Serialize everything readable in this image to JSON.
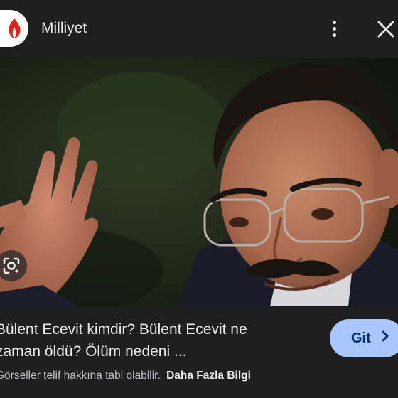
{
  "header": {
    "source_name": "Milliyet",
    "logo_icon": "milliyet-flame-logo",
    "menu_icon": "more-vert-icon",
    "close_icon": "close-icon"
  },
  "image": {
    "alt": "Bülent Ecevit",
    "lens_icon": "google-lens-icon"
  },
  "result": {
    "title_line1": "Bülent Ecevit kimdir? Bülent Ecevit ne",
    "title_line2": "zaman öldü? Ölüm nedeni ...",
    "go_label": "Git",
    "go_icon": "chevron-right-icon"
  },
  "footer": {
    "notice": "Görseller telif hakkına tabi olabilir.",
    "more_link": "Daha Fazla Bilgi"
  },
  "colors": {
    "background": "#1f1f1f",
    "button": "#a8c7fa",
    "logo_red": "#e2231a"
  }
}
